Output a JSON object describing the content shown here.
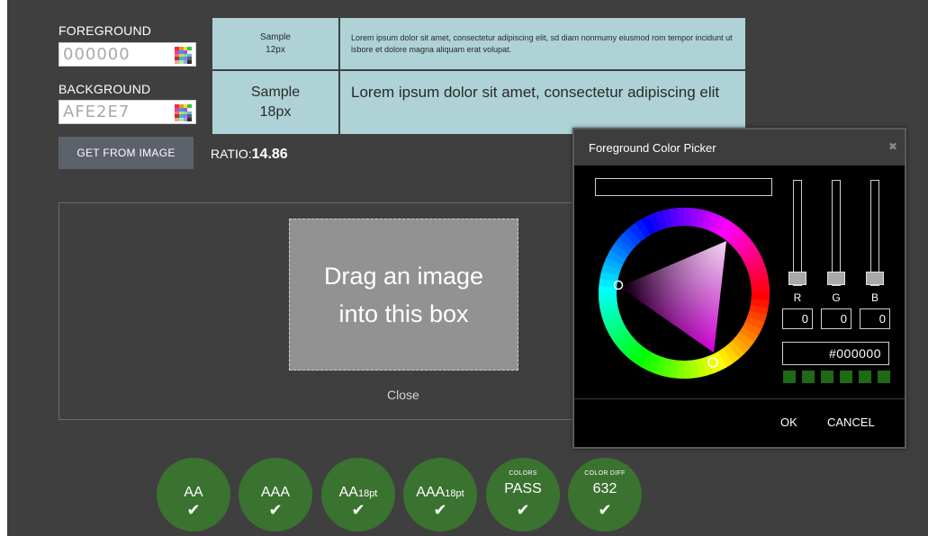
{
  "colors": {
    "page_bg": "#3f3f3f",
    "sample_bg": "#aed2d6",
    "badge_green": "#3a7230",
    "button_gray": "#5c616b",
    "picker_bg": "#000000",
    "picker_header": "#3d3d3d"
  },
  "foreground": {
    "label": "FOREGROUND",
    "value": "000000",
    "palette_icon": "color-palette-icon"
  },
  "background": {
    "label": "BACKGROUND",
    "value": "AFE2E7",
    "palette_icon": "color-palette-icon"
  },
  "get_from_image_label": "GET FROM IMAGE",
  "ratio": {
    "label": "RATIO:",
    "value": "14.86"
  },
  "samples": [
    {
      "title": "Sample",
      "size": "12px",
      "text": "Lorem ipsum dolor sit amet, consectetur adipiscing elit, sd diam nonmumy eiusmod rom tempor incidunt ut lsbore et dolore magna aliquam erat volupat."
    },
    {
      "title": "Sample",
      "size": "18px",
      "text": "Lorem ipsum dolor sit amet, consectetur adipiscing elit"
    }
  ],
  "drop": {
    "text": "Drag an image into this box",
    "close_label": "Close"
  },
  "badges": [
    {
      "main": "AA",
      "sub": "",
      "top": "",
      "check_icon": "check-icon"
    },
    {
      "main": "AAA",
      "sub": "",
      "top": "",
      "check_icon": "check-icon"
    },
    {
      "main": "AA",
      "sub": "18pt",
      "top": "",
      "check_icon": "check-icon"
    },
    {
      "main": "AAA",
      "sub": "18pt",
      "top": "",
      "check_icon": "check-icon"
    },
    {
      "main": "PASS",
      "sub": "",
      "top": "COLORS",
      "check_icon": "check-icon"
    },
    {
      "main": "632",
      "sub": "",
      "top": "COLOR DIFF",
      "check_icon": "check-icon"
    }
  ],
  "picker": {
    "title": "Foreground Color Picker",
    "close_icon": "close-icon",
    "channels": [
      {
        "label": "R",
        "value": "0"
      },
      {
        "label": "G",
        "value": "0"
      },
      {
        "label": "B",
        "value": "0"
      }
    ],
    "hex": "#000000",
    "ok_label": "OK",
    "cancel_label": "CANCEL",
    "swatch_color": "#1e6a15"
  }
}
